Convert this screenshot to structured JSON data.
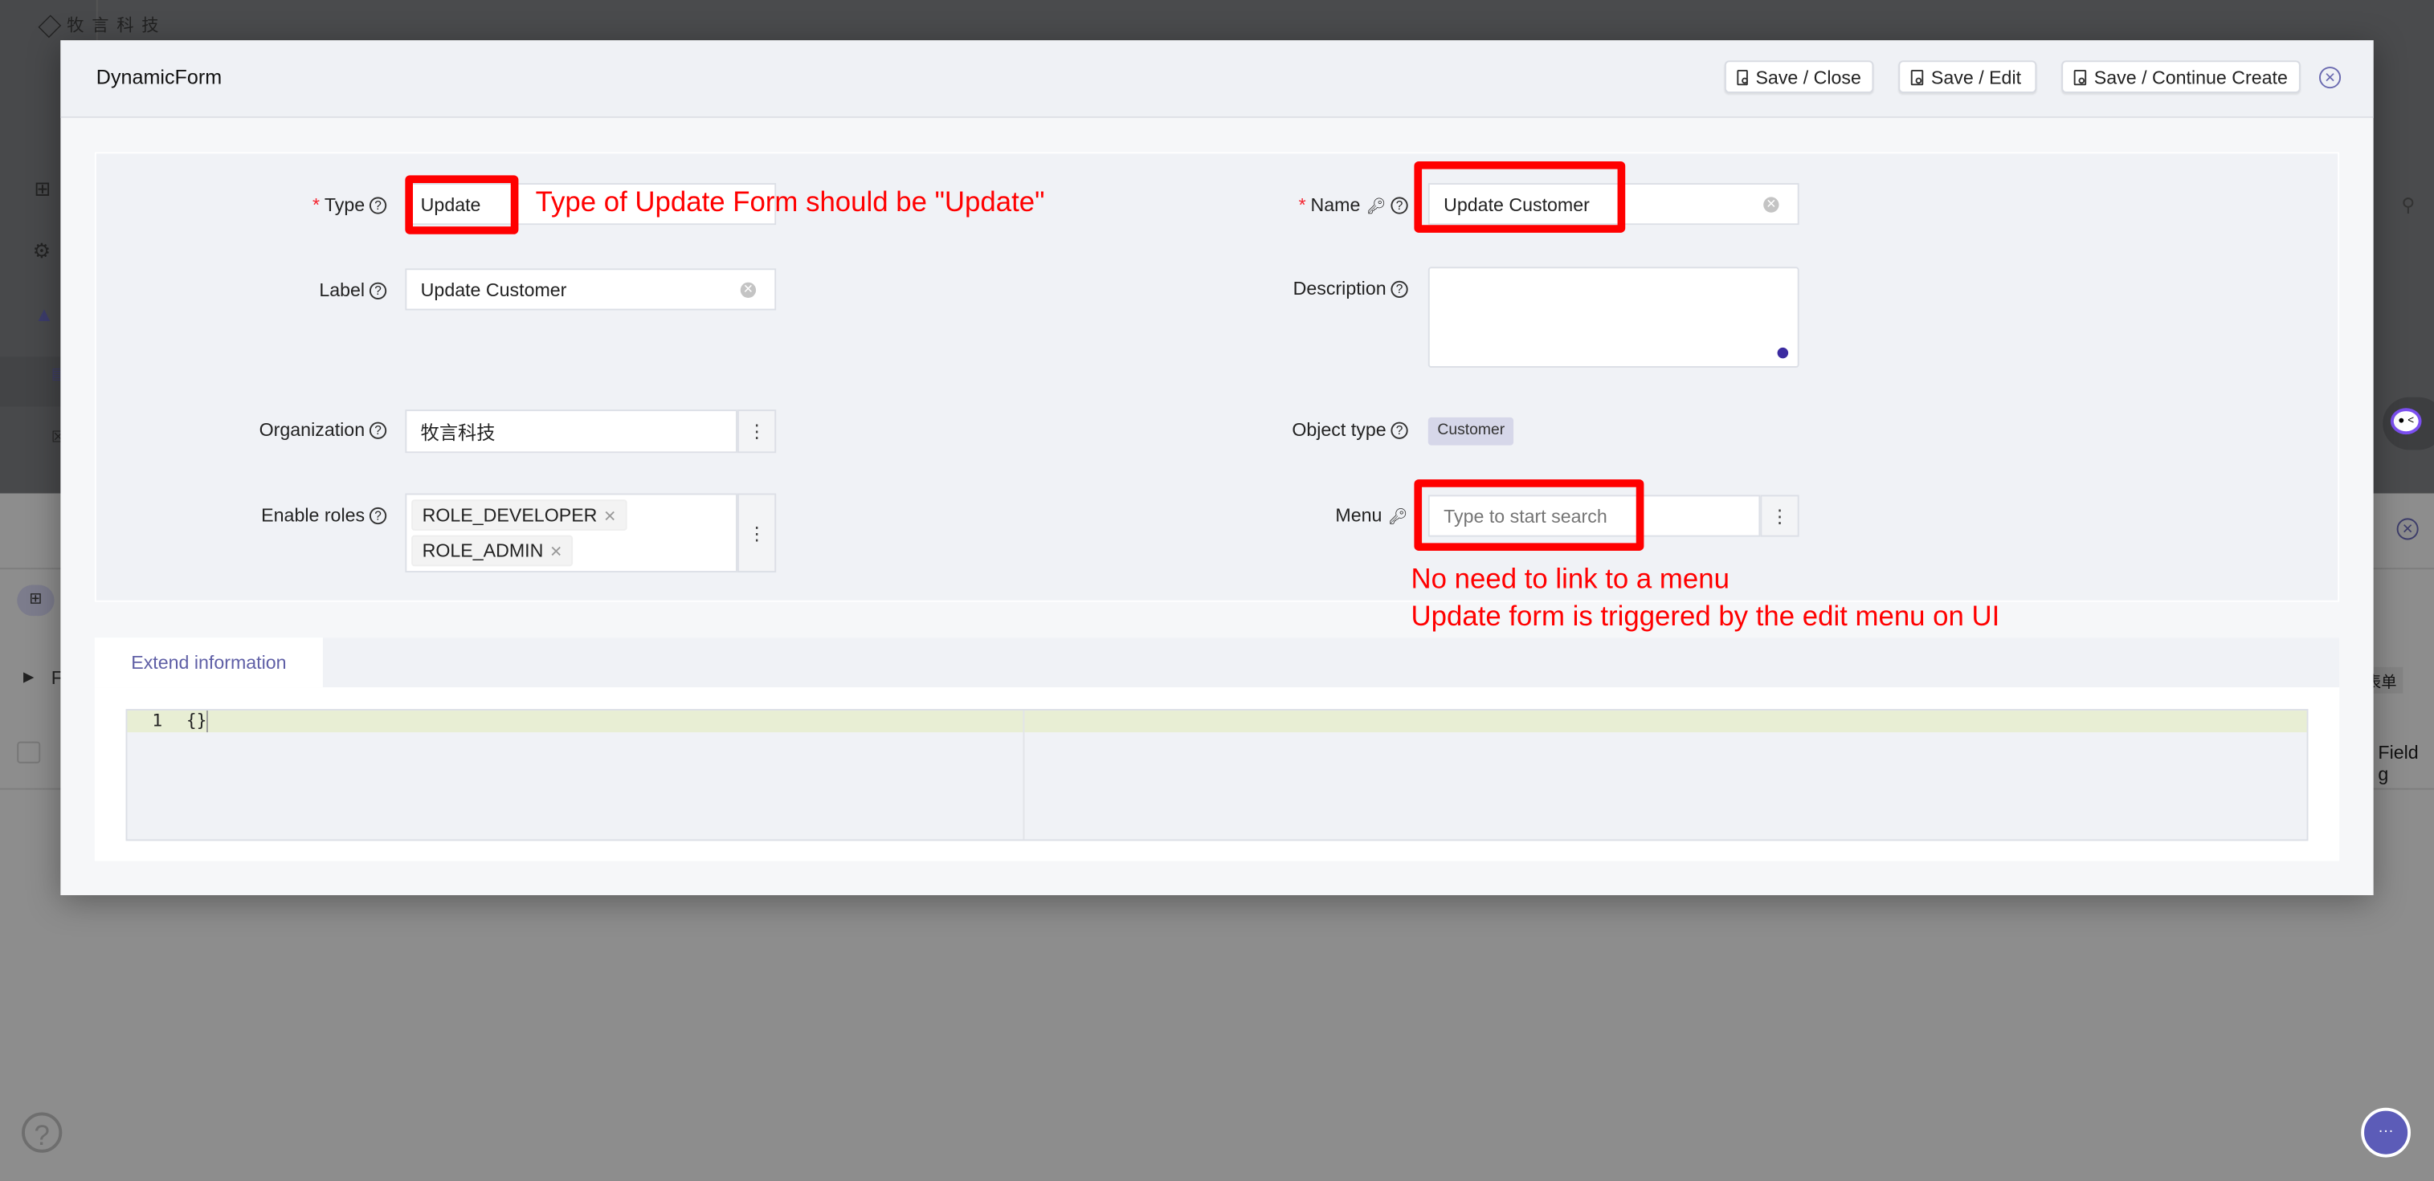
{
  "background": {
    "logo_text": "牧 言 科 技",
    "right_tag": "表单",
    "right_column": "Field g",
    "left_row_letter": "F"
  },
  "modal": {
    "title": "DynamicForm",
    "buttons": {
      "save_close": "Save / Close",
      "save_edit": "Save / Edit",
      "save_continue": "Save / Continue Create"
    },
    "fields": {
      "type": {
        "label": "Type",
        "value": "Update",
        "required": true
      },
      "name": {
        "label": "Name",
        "value": "Update Customer",
        "required": true
      },
      "label": {
        "label": "Label",
        "value": "Update Customer"
      },
      "description": {
        "label": "Description",
        "value": ""
      },
      "organization": {
        "label": "Organization",
        "value": "牧言科技"
      },
      "object_type": {
        "label": "Object type",
        "value": "Customer"
      },
      "enable_roles": {
        "label": "Enable roles",
        "values": [
          "ROLE_DEVELOPER",
          "ROLE_ADMIN"
        ]
      },
      "menu": {
        "label": "Menu",
        "value": "",
        "placeholder": "Type to start search"
      }
    },
    "tabs": [
      {
        "label": "Extend information",
        "active": true
      }
    ],
    "editor": {
      "line_number": "1",
      "content": "{}"
    }
  },
  "annotations": {
    "type_note": "Type of Update Form should be \"Update\"",
    "menu_note_1": "No need to link to a menu",
    "menu_note_2": "Update form is triggered by the edit menu on UI",
    "color": "#ff0000"
  },
  "colors": {
    "accent": "#5f5fa6",
    "required": "#f5222d"
  }
}
